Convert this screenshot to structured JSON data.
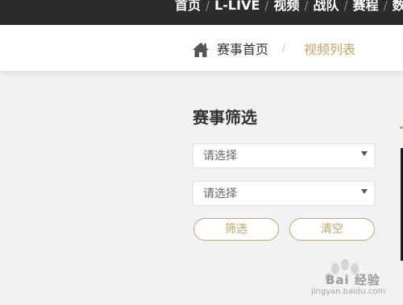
{
  "topnav": {
    "items": [
      {
        "label": "首页"
      },
      {
        "label": "L-LIVE"
      },
      {
        "label": "视频"
      },
      {
        "label": "战队"
      },
      {
        "label": "赛程"
      },
      {
        "label": "数"
      }
    ],
    "separator": "/"
  },
  "breadcrumb": {
    "home_icon": "home-icon",
    "home_label": "赛事首页",
    "separator": "/",
    "current_label": "视频列表"
  },
  "filter": {
    "title": "赛事筛选",
    "select_1": {
      "value": "请选择"
    },
    "select_2": {
      "value": "请选择"
    },
    "filter_button": "筛选",
    "clear_button": "清空"
  },
  "colors": {
    "accent": "#c8a368",
    "nav_bg": "#2b2b2b",
    "page_bg": "#f2f2f2"
  },
  "watermark": {
    "text": "Bai 经验",
    "sub": "jingyan.baidu.com"
  }
}
